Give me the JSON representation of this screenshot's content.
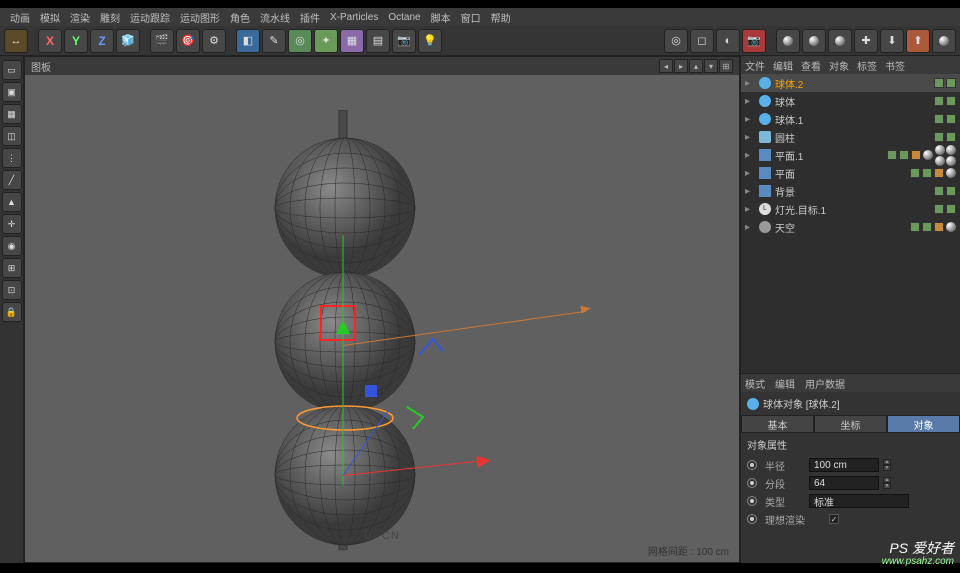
{
  "menu": {
    "items": [
      "动画",
      "模拟",
      "渲染",
      "雕刻",
      "运动跟踪",
      "运动图形",
      "角色",
      "流水线",
      "插件",
      "X-Particles",
      "Octane",
      "脚本",
      "窗口",
      "帮助"
    ]
  },
  "toolbar": {
    "axes": [
      "X",
      "Y",
      "Z"
    ]
  },
  "viewport": {
    "label": "图板",
    "footer_left": "",
    "logo": "UI·CN",
    "grid_label": "网格间距 : 100 cm"
  },
  "panels": {
    "obj_tabs": [
      "文件",
      "编辑",
      "查看",
      "对象",
      "标签",
      "书签"
    ]
  },
  "objects": [
    {
      "name": "球体.2",
      "icon": "sphere",
      "sel": true,
      "tags": [
        "g",
        "g"
      ]
    },
    {
      "name": "球体",
      "icon": "sphere",
      "tags": [
        "g",
        "g"
      ]
    },
    {
      "name": "球体.1",
      "icon": "sphere",
      "tags": [
        "g",
        "g"
      ]
    },
    {
      "name": "圆柱",
      "icon": "cyl",
      "tags": [
        "g",
        "g"
      ]
    },
    {
      "name": "平面.1",
      "icon": "plane",
      "tags": [
        "g",
        "g",
        "o"
      ],
      "mat": true,
      "mat2": true
    },
    {
      "name": "平面",
      "icon": "plane",
      "tags": [
        "g",
        "g",
        "o"
      ],
      "mat": true
    },
    {
      "name": "背景",
      "icon": "plane",
      "tags": [
        "g",
        "g"
      ]
    },
    {
      "name": "灯光.目标.1",
      "icon": "light",
      "tags": [
        "g",
        "g"
      ]
    },
    {
      "name": "天空",
      "icon": "sky",
      "tags": [
        "g",
        "g",
        "o"
      ],
      "matSingle": true
    }
  ],
  "attr": {
    "tabs": [
      "模式",
      "编辑",
      "用户数据"
    ],
    "title": "球体对象 [球体.2]",
    "subtabs": [
      "基本",
      "坐标",
      "对象"
    ],
    "section_title": "对象属性",
    "radius_label": "半径",
    "radius_value": "100 cm",
    "segments_label": "分段",
    "segments_value": "64",
    "type_label": "类型",
    "type_value": "标准",
    "ideal_label": "理想渲染"
  },
  "watermark": {
    "title": "PS 爱好者",
    "url": "www.psahz.com"
  }
}
